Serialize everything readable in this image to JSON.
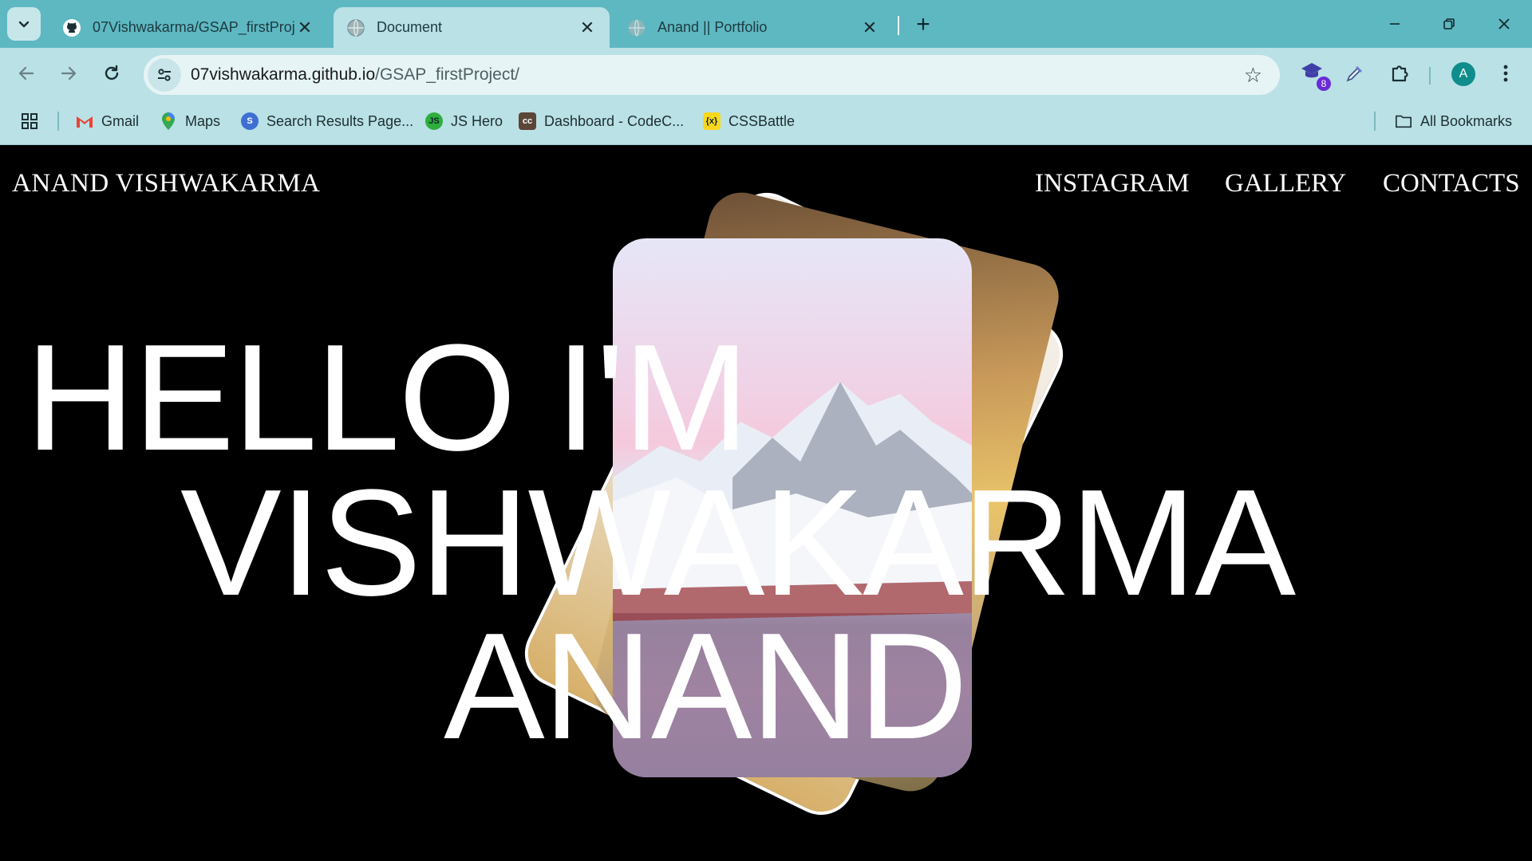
{
  "browser": {
    "tabs": [
      {
        "title": "07Vishwakarma/GSAP_firstProje",
        "icon": "github-icon"
      },
      {
        "title": "Document",
        "icon": "globe-icon"
      },
      {
        "title": "Anand || Portfolio",
        "icon": "globe-icon"
      }
    ],
    "address": {
      "host": "07vishwakarma.github.io",
      "path": "/GSAP_firstProject/"
    },
    "extension_badge": "8",
    "profile_initial": "A",
    "bookmarks": [
      {
        "label": "Gmail",
        "icon": "gmail-icon"
      },
      {
        "label": "Maps",
        "icon": "maps-icon"
      },
      {
        "label": "Search Results Page...",
        "icon": "search-results-icon"
      },
      {
        "label": "JS Hero",
        "icon": "js-hero-icon"
      },
      {
        "label": "Dashboard - CodeC...",
        "icon": "codechef-icon"
      },
      {
        "label": "CSSBattle",
        "icon": "cssbattle-icon"
      }
    ],
    "all_bookmarks_label": "All Bookmarks",
    "accent": "#5eb8c2"
  },
  "site": {
    "brand": "ANAND VISHWAKARMA",
    "nav": [
      "INSTAGRAM",
      "GALLERY",
      "CONTACTS"
    ],
    "headline": [
      "HELLO I'M",
      "VISHWAKARMA",
      "ANAND"
    ]
  }
}
